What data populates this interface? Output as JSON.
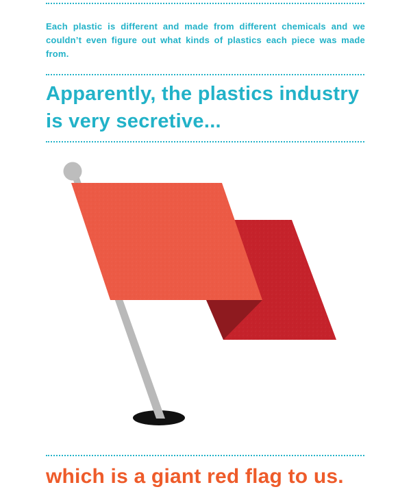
{
  "intro": {
    "text": "Each plastic is different and made from different chemicals and we couldn’t even figure out what kinds of plastics each piece was made from."
  },
  "heading": {
    "line1": "Apparently, the plastics industry",
    "line2": "is very secretive..."
  },
  "illustration": {
    "icon": "red-flag-icon",
    "colors": {
      "front_panel": "#ec5a45",
      "back_panel": "#c5222b",
      "fold_shadow": "#8e1a1f",
      "pole": "#b9b9b9",
      "pole_top": "#bdbdbd",
      "hole": "#111111"
    }
  },
  "conclusion": {
    "text": "which is a giant red flag to us."
  },
  "colors": {
    "teal_text": "#22b2c8",
    "orange_text": "#ee5b2a",
    "divider": "#22b2c8"
  }
}
